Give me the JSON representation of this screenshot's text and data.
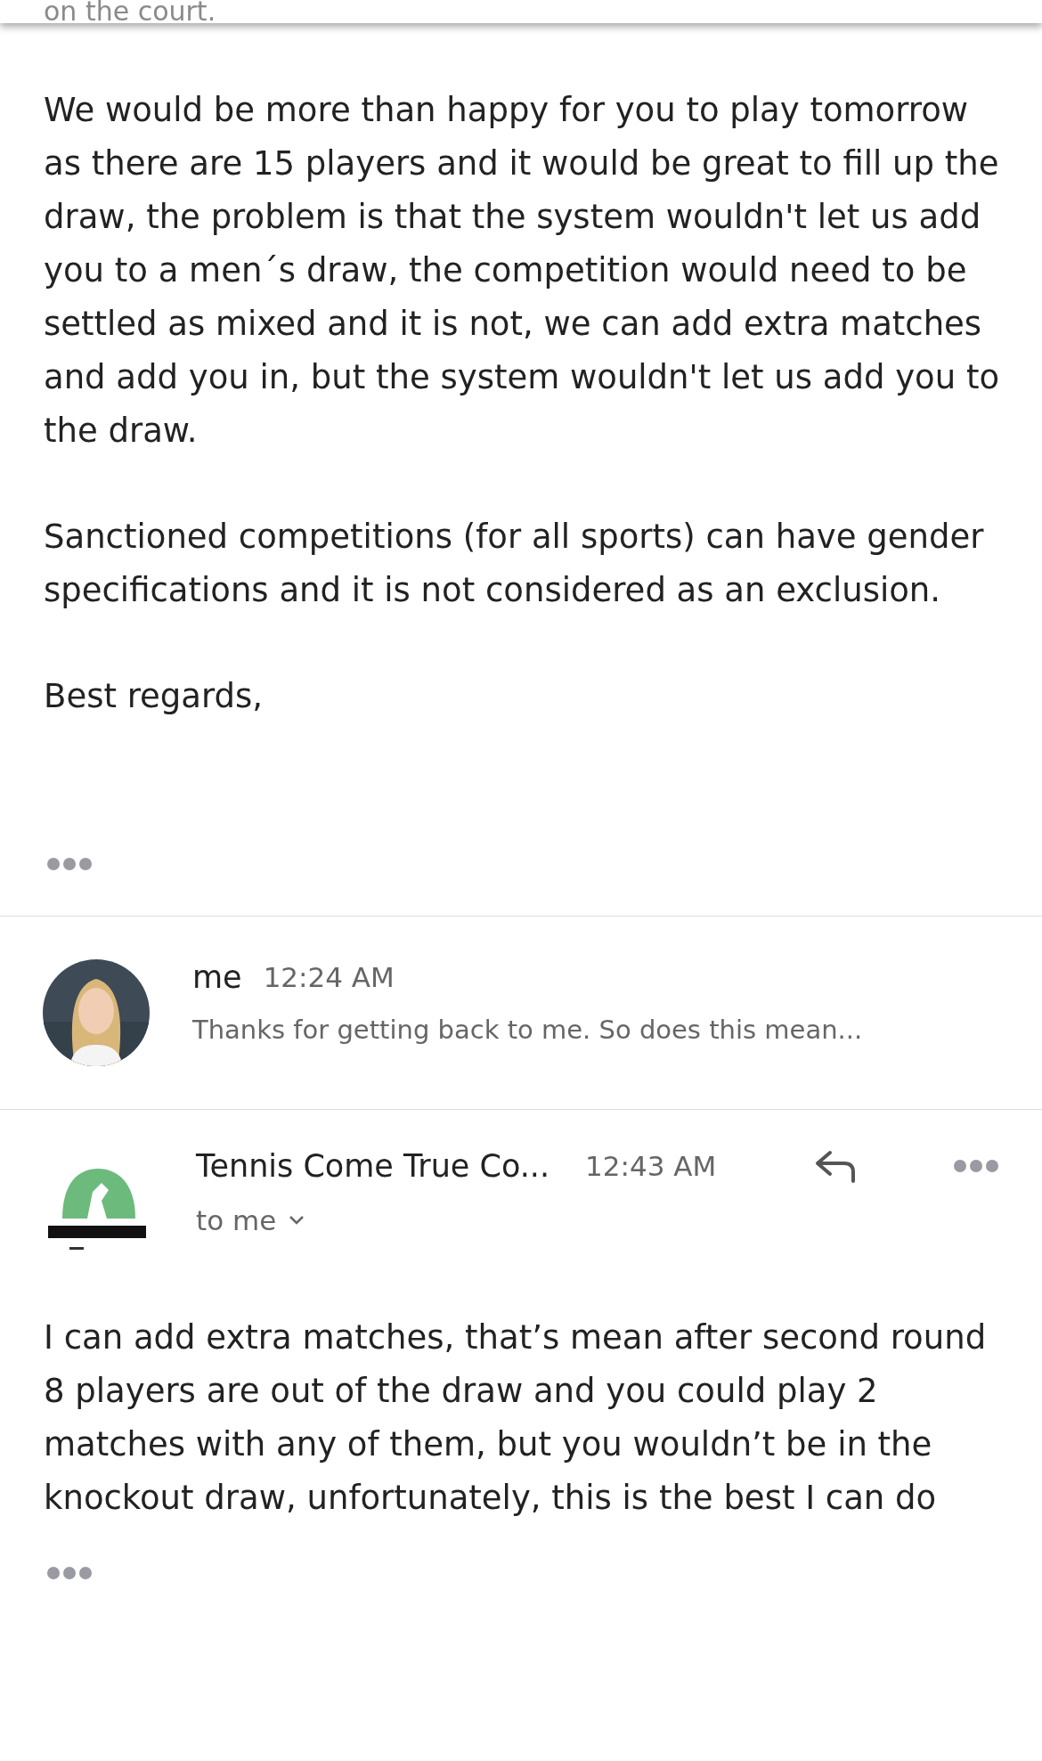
{
  "cut_text": "on the court.",
  "first_message": {
    "paragraphs": [
      "We would be more than happy for you to play tomorrow as there are 15 players and it would be great to fill up the draw, the problem is that the system wouldn't let us add you to a men´s draw, the competition would need to be settled as mixed and it is not, we can add extra matches and add you in, but the system wouldn't let us add you to the draw.",
      "Sanctioned competitions (for all sports) can have gender specifications and it is not considered as an exclusion.",
      "Best regards,"
    ]
  },
  "collapsed_message": {
    "sender": "me",
    "time": "12:24 AM",
    "snippet": "Thanks for getting back to me. So does this mean..."
  },
  "last_message": {
    "sender": "Tennis Come True Co...",
    "time": "12:43 AM",
    "recipient": "to me",
    "paragraphs": [
      "I can add extra matches, that’s mean after second round 8 players are out of the draw and you could play 2 matches with any of them, but you wouldn’t be in the knockout draw, unfortunately, this is the best I can do"
    ]
  }
}
